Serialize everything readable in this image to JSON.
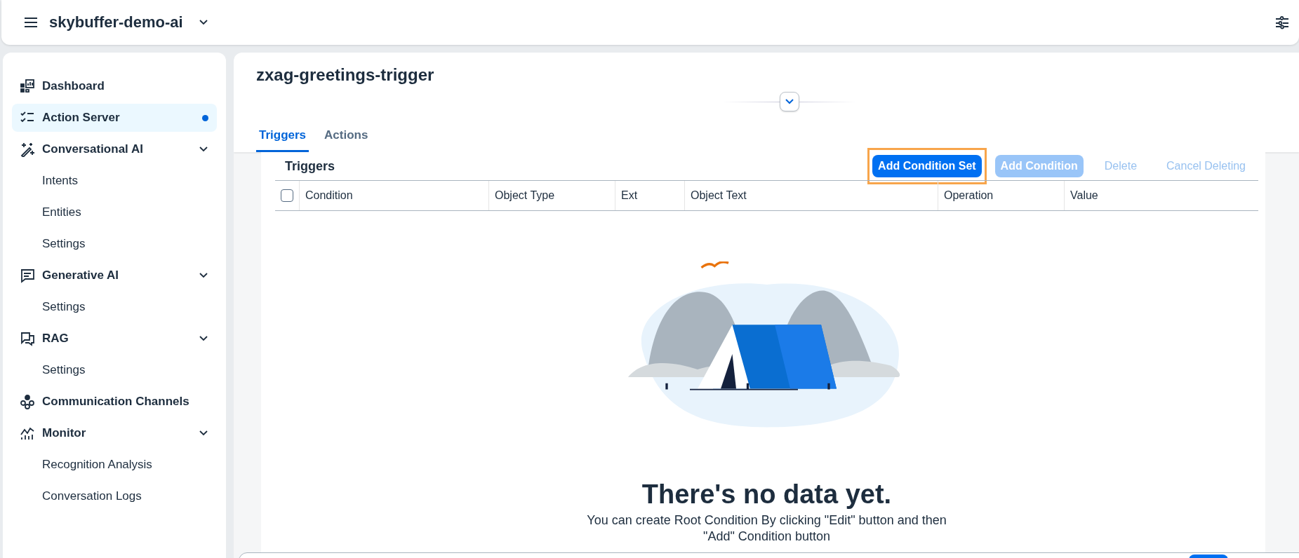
{
  "shell": {
    "title": "skybuffer-demo-ai"
  },
  "sidebar": {
    "items": [
      {
        "label": "Dashboard",
        "selected": false
      },
      {
        "label": "Action Server",
        "selected": true
      },
      {
        "label": "Conversational AI",
        "selected": false,
        "expanded": true,
        "children": [
          {
            "label": "Intents",
            "selected": false
          },
          {
            "label": "Entities",
            "selected": false
          },
          {
            "label": "Settings",
            "selected": false
          }
        ]
      },
      {
        "label": "Generative AI",
        "selected": false,
        "expanded": true,
        "children": [
          {
            "label": "Settings",
            "selected": false
          }
        ]
      },
      {
        "label": "RAG",
        "selected": false,
        "expanded": true,
        "children": [
          {
            "label": "Settings",
            "selected": false
          }
        ]
      },
      {
        "label": "Communication Channels",
        "selected": false
      },
      {
        "label": "Monitor",
        "selected": false,
        "expanded": true,
        "children": [
          {
            "label": "Recognition Analysis",
            "selected": false
          },
          {
            "label": "Conversation Logs",
            "selected": false
          }
        ]
      }
    ]
  },
  "page": {
    "title": "zxag-greetings-trigger",
    "tabs": [
      {
        "label": "Triggers",
        "selected": true
      },
      {
        "label": "Actions",
        "selected": false
      }
    ],
    "section_title": "Triggers",
    "toolbar": [
      {
        "label": "Add Condition Set",
        "kind": "emphasized",
        "disabled": false,
        "highlighted": true
      },
      {
        "label": "Add Condition",
        "kind": "emphasized",
        "disabled": true,
        "highlighted": false
      },
      {
        "label": "Delete",
        "kind": "transparent",
        "disabled": true,
        "highlighted": false
      },
      {
        "label": "Cancel Deleting",
        "kind": "transparent",
        "disabled": true,
        "highlighted": false
      }
    ],
    "table": {
      "select_all_checked": false,
      "columns": [
        "Condition",
        "Object Type",
        "Ext",
        "Object Text",
        "Operation",
        "Value"
      ]
    },
    "empty_state": {
      "title": "There's no data yet.",
      "text": "You can create Root Condition By clicking \"Edit\" button and then \"Add\" Condition button"
    }
  }
}
